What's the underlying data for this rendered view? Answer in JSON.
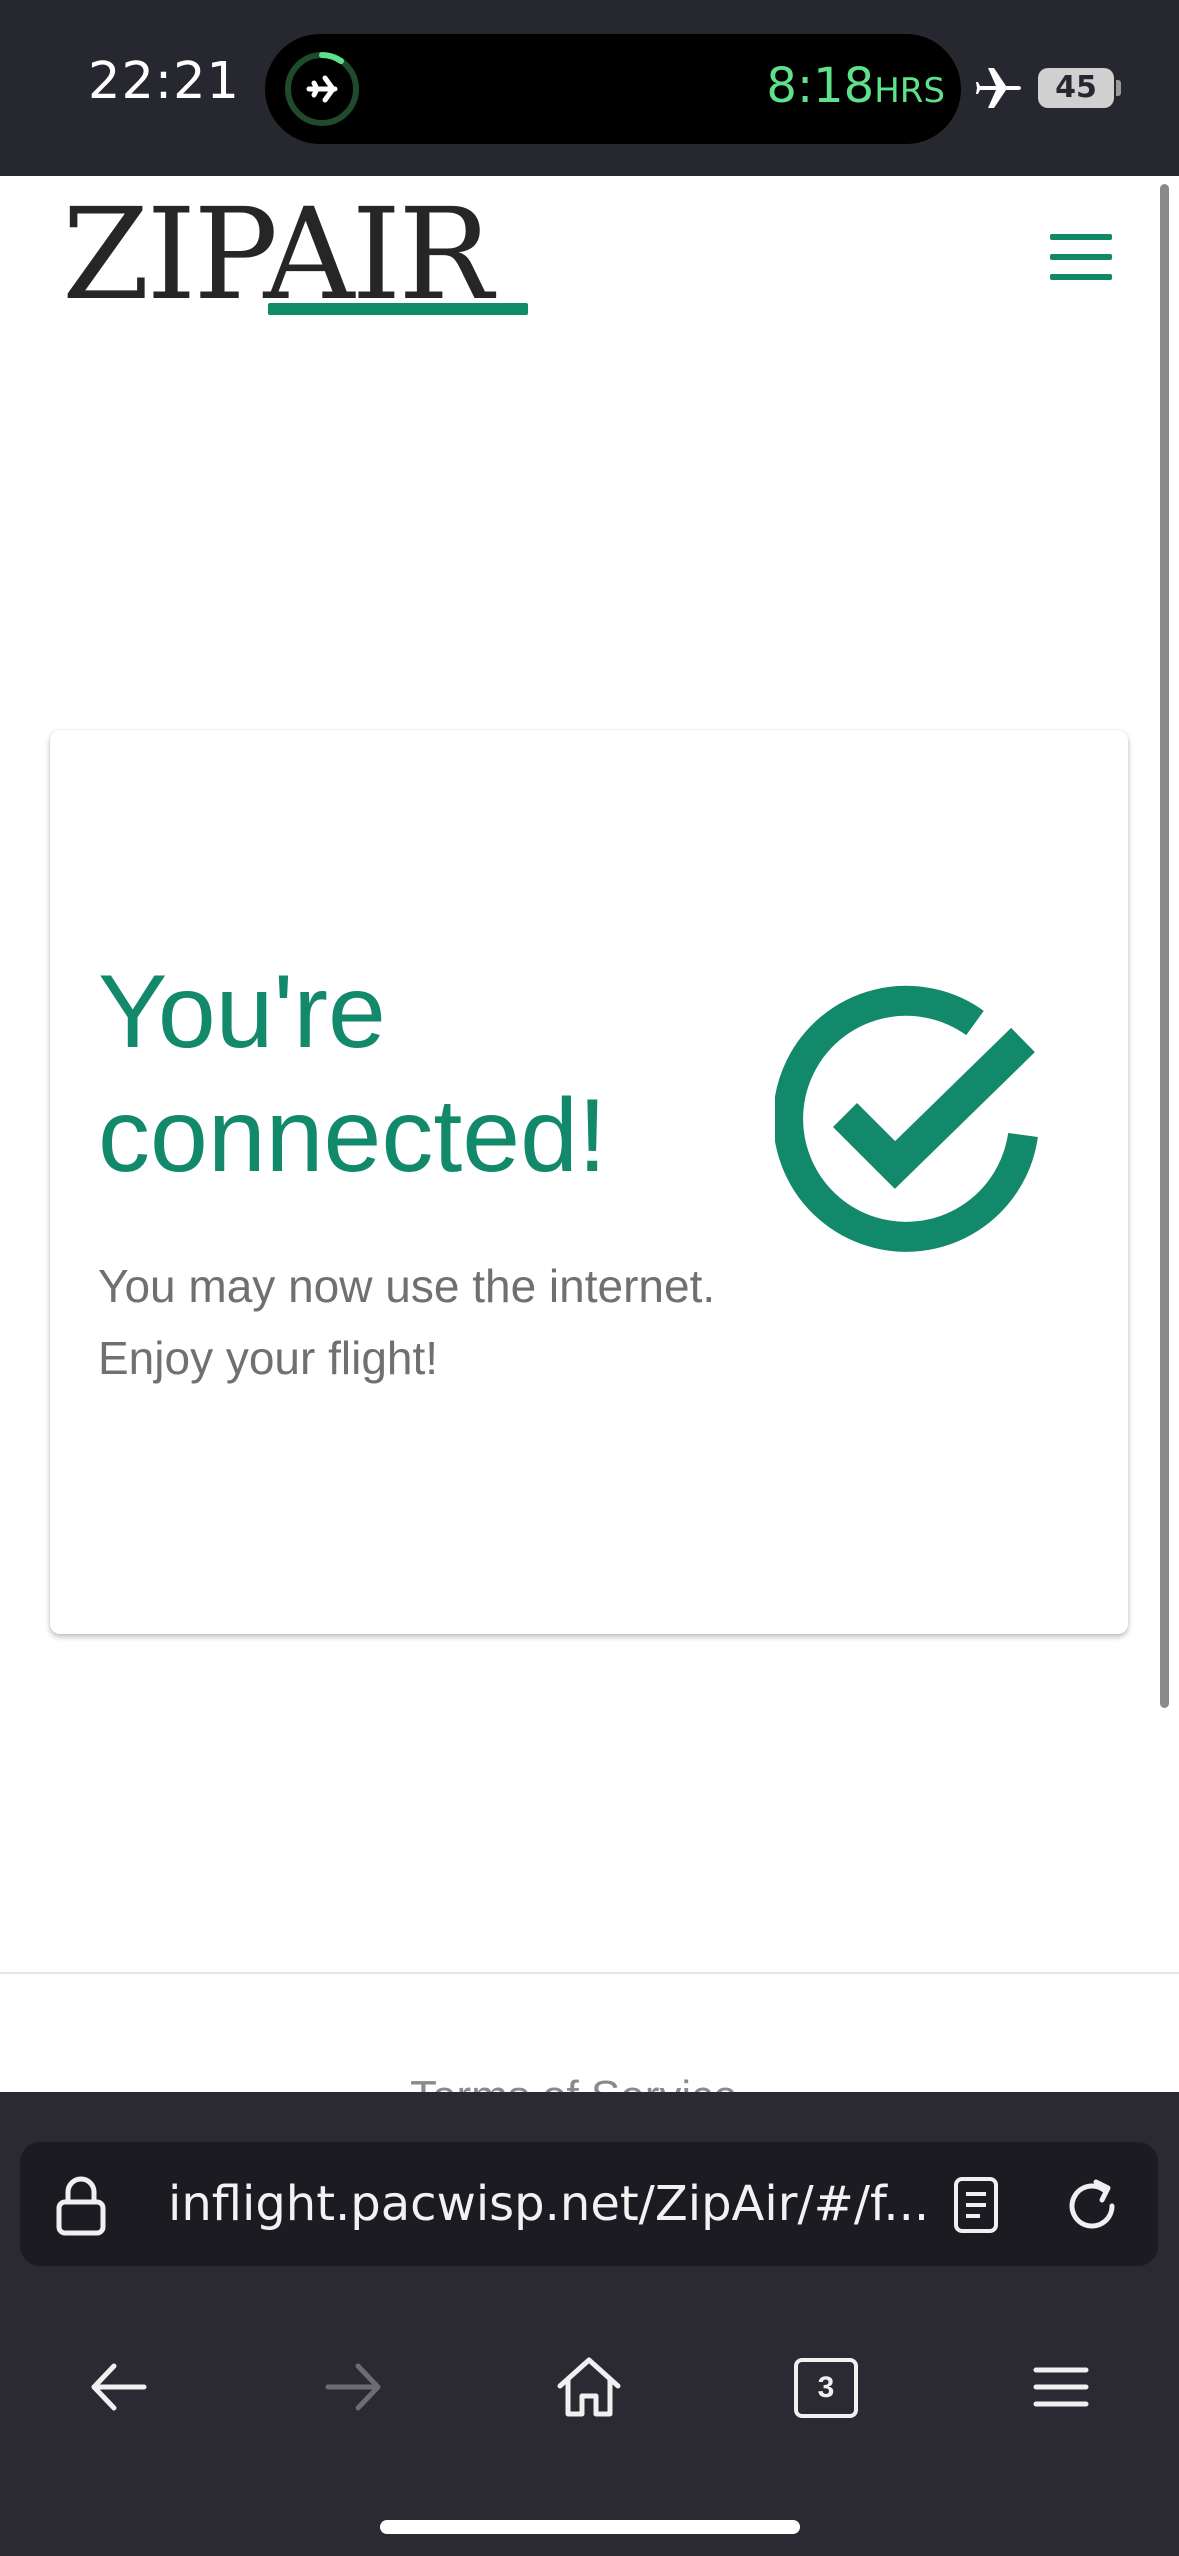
{
  "status_bar": {
    "time": "22:21",
    "flight_time_value": "8:18",
    "flight_time_unit": "HRS",
    "battery": "45",
    "accent_color": "#5fe08a"
  },
  "header": {
    "logo_text": "ZIPAIR",
    "brand_color": "#11896a",
    "menu_icon": "hamburger-menu-icon"
  },
  "card": {
    "title": "You're connected!",
    "message_line1": "You may now use the internet.",
    "message_line2": "Enjoy your flight!",
    "icon": "check-circle-icon"
  },
  "footer": {
    "link_text": "Terms of Service"
  },
  "browser": {
    "url": "inflight.pacwisp.net/ZipAir/#/f...",
    "tab_count": "3",
    "icons": [
      "lock-icon",
      "reader-mode-icon",
      "reload-icon",
      "back-arrow-icon",
      "forward-arrow-icon",
      "home-icon",
      "tabs-icon",
      "menu-icon"
    ]
  }
}
